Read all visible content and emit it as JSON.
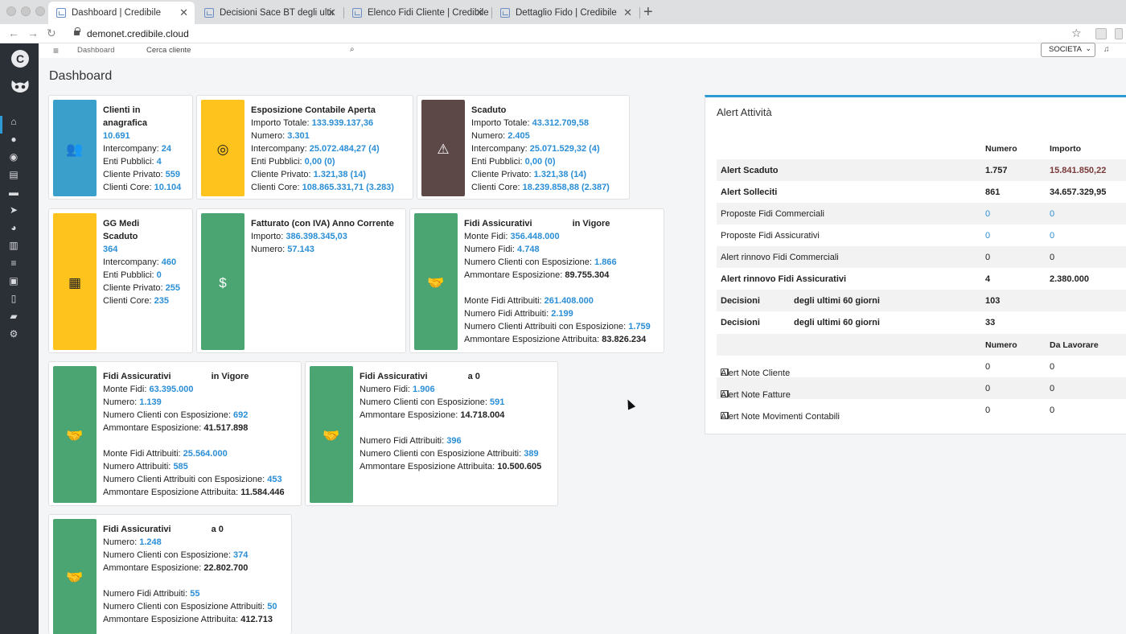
{
  "browser": {
    "tabs": [
      {
        "label": "Dashboard | Credibile"
      },
      {
        "label": "Decisioni Sace BT degli ultimi"
      },
      {
        "label": "Elenco Fidi Cliente | Credibile"
      },
      {
        "label": "Dettaglio Fido | Credibile"
      }
    ],
    "url": "demonet.credibile.cloud"
  },
  "topbar": {
    "nav_dashboard": "Dashboard",
    "nav_cerca": "Cerca cliente",
    "societa_select": "SOCIETA"
  },
  "page": {
    "title": "Dashboard"
  },
  "cards": {
    "clienti": {
      "title_1": "Clienti in",
      "title_2": "anagrafica",
      "value": "10.691",
      "l_intercompany": "Intercompany:",
      "v_intercompany": "24",
      "l_enti": "Enti Pubblici:",
      "v_enti": "4",
      "l_privato": "Cliente Privato:",
      "v_privato": "559",
      "l_core": "Clienti Core:",
      "v_core": "10.104"
    },
    "esposizione": {
      "title": "Esposizione Contabile Aperta",
      "l_importo": "Importo Totale:",
      "v_importo": "133.939.137,36",
      "l_numero": "Numero:",
      "v_numero": "3.301",
      "l_intercompany": "Intercompany:",
      "v_intercompany": "25.072.484,27 (4)",
      "l_enti": "Enti Pubblici:",
      "v_enti": "0,00 (0)",
      "l_privato": "Cliente Privato:",
      "v_privato": "1.321,38 (14)",
      "l_core": "Clienti Core:",
      "v_core": "108.865.331,71 (3.283)"
    },
    "scaduto": {
      "title": "Scaduto",
      "l_importo": "Importo Totale:",
      "v_importo": "43.312.709,58",
      "l_numero": "Numero:",
      "v_numero": "2.405",
      "l_intercompany": "Intercompany:",
      "v_intercompany": "25.071.529,32 (4)",
      "l_enti": "Enti Pubblici:",
      "v_enti": "0,00 (0)",
      "l_privato": "Cliente Privato:",
      "v_privato": "1.321,38 (14)",
      "l_core": "Clienti Core:",
      "v_core": "18.239.858,88 (2.387)"
    },
    "gg": {
      "title_1": "GG Medi",
      "title_2": "Scaduto",
      "value": "364",
      "l_intercompany": "Intercompany:",
      "v_intercompany": "460",
      "l_enti": "Enti Pubblici:",
      "v_enti": "0",
      "l_privato": "Cliente Privato:",
      "v_privato": "255",
      "l_core": "Clienti Core:",
      "v_core": "235"
    },
    "fatturato": {
      "title": "Fatturato (con IVA) Anno Corrente",
      "l_importo": "Importo:",
      "v_importo": "386.398.345,03",
      "l_numero": "Numero:",
      "v_numero": "57.143"
    },
    "fidi1": {
      "title_a": "Fidi Assicurativi",
      "title_b": "in Vigore",
      "l_monte": "Monte Fidi:",
      "v_monte": "356.448.000",
      "l_numero": "Numero Fidi:",
      "v_numero": "4.748",
      "l_ncl": "Numero Clienti con Esposizione:",
      "v_ncl": "1.866",
      "l_amm": "Ammontare Esposizione:",
      "v_amm": "89.755.304",
      "l_monte_attr": "Monte Fidi Attribuiti:",
      "v_monte_attr": "261.408.000",
      "l_num_attr": "Numero Fidi Attribuiti:",
      "v_num_attr": "2.199",
      "l_ncl_attr": "Numero Clienti Attribuiti con Esposizione:",
      "v_ncl_attr": "1.759",
      "l_amm_attr": "Ammontare Esposizione Attribuita:",
      "v_amm_attr": "83.826.234"
    },
    "fidi2": {
      "title_a": "Fidi Assicurativi",
      "title_b": "in Vigore",
      "l_monte": "Monte Fidi:",
      "v_monte": "63.395.000",
      "l_numero": "Numero:",
      "v_numero": "1.139",
      "l_ncl": "Numero Clienti con Esposizione:",
      "v_ncl": "692",
      "l_amm": "Ammontare Esposizione:",
      "v_amm": "41.517.898",
      "l_monte_attr": "Monte Fidi Attribuiti:",
      "v_monte_attr": "25.564.000",
      "l_num_attr": "Numero Attribuiti:",
      "v_num_attr": "585",
      "l_ncl_attr": "Numero Clienti Attribuiti con Esposizione:",
      "v_ncl_attr": "453",
      "l_amm_attr": "Ammontare Esposizione Attribuita:",
      "v_amm_attr": "11.584.446"
    },
    "fidi3": {
      "title_a": "Fidi Assicurativi",
      "title_b": "a 0",
      "l_numero": "Numero Fidi:",
      "v_numero": "1.906",
      "l_ncl": "Numero Clienti con Esposizione:",
      "v_ncl": "591",
      "l_amm": "Ammontare Esposizione:",
      "v_amm": "14.718.004",
      "l_num_attr": "Numero Fidi Attribuiti:",
      "v_num_attr": "396",
      "l_ncl_attr": "Numero Clienti con Esposizione Attribuiti:",
      "v_ncl_attr": "389",
      "l_amm_attr": "Ammontare Esposizione Attribuita:",
      "v_amm_attr": "10.500.605"
    },
    "fidi4": {
      "title_a": "Fidi Assicurativi",
      "title_b": "a 0",
      "l_numero": "Numero:",
      "v_numero": "1.248",
      "l_ncl": "Numero Clienti con Esposizione:",
      "v_ncl": "374",
      "l_amm": "Ammontare Esposizione:",
      "v_amm": "22.802.700",
      "l_num_attr": "Numero Fidi Attribuiti:",
      "v_num_attr": "55",
      "l_ncl_attr": "Numero Clienti con Esposizione Attribuiti:",
      "v_ncl_attr": "50",
      "l_amm_attr": "Ammontare Esposizione Attribuita:",
      "v_amm_attr": "412.713"
    }
  },
  "alerts": {
    "title": "Alert Attività",
    "head1": {
      "c2": "Numero",
      "c3": "Importo"
    },
    "rows": [
      {
        "label": "Alert Scaduto",
        "numero": "1.757",
        "importo": "15.841.850,22"
      },
      {
        "label": "Alert Solleciti",
        "numero": "861",
        "importo": "34.657.329,95"
      },
      {
        "label": "Proposte Fidi Commerciali",
        "numero": "0",
        "importo": "0"
      },
      {
        "label": "Proposte Fidi Assicurativi",
        "numero": "0",
        "importo": "0"
      },
      {
        "label": "Alert rinnovo Fidi Commerciali",
        "numero": "0",
        "importo": "0"
      },
      {
        "label": "Alert rinnovo Fidi Assicurativi",
        "numero": "4",
        "importo": "2.380.000"
      },
      {
        "label_a": "Decisioni",
        "label_b": "degli ultimi 60 giorni",
        "numero": "103"
      },
      {
        "label_a": "Decisioni",
        "label_b": "degli ultimi 60 giorni",
        "numero": "33"
      }
    ],
    "head2": {
      "c2": "Numero",
      "c3": "Da Lavorare"
    },
    "notes": [
      {
        "label": "Alert Note Cliente",
        "numero": "0",
        "lavorare": "0"
      },
      {
        "label": "Alert Note Fatture",
        "numero": "0",
        "lavorare": "0"
      },
      {
        "label": "Alert Note Movimenti Contabili",
        "numero": "0",
        "lavorare": "0"
      }
    ]
  },
  "colors": {
    "blue": "#3a9fcb",
    "yellow": "#fec31c",
    "maroon": "#5d4848",
    "green": "#4aa572",
    "link": "#2a8ed6",
    "accent": "#2f9bd6"
  }
}
